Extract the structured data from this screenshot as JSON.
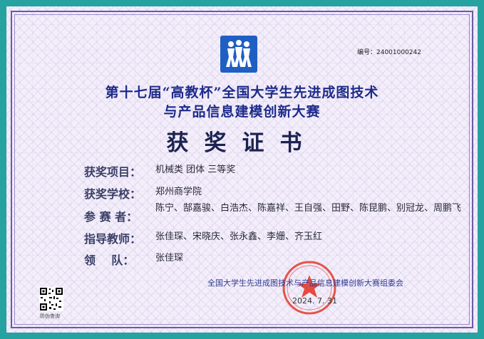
{
  "certificate": {
    "serial_no": "编号：24001000242",
    "title_line1": "第十七届“高教杯”全国大学生先进成图技术",
    "title_line2": "与产品信息建模创新大赛",
    "cert_title": "获奖证书"
  },
  "fields": {
    "project": {
      "label": "获奖项目",
      "value": "机械类 团体 三等奖"
    },
    "school": {
      "label": "获奖学校",
      "value": "郑州商学院"
    },
    "participants": {
      "label": "参 赛 者",
      "value": "陈宁、郜嘉骏、白浩杰、陈嘉祥、王自强、田野、陈昆鹏、别冠龙、周鹏飞"
    },
    "advisors": {
      "label": "指导教师",
      "value": "张佳琛、宋晓庆、张永鑫、李姗、齐玉红"
    },
    "leader": {
      "label": "领    队",
      "value": "张佳琛"
    }
  },
  "footer": {
    "organizer": "全国大学生先进成图技术与产品信息建模创新大赛组委会",
    "date": "2024. 7. 31",
    "qr_label": "防伪查询"
  },
  "colors": {
    "border": "#26a2a0",
    "title": "#1e2b8a",
    "logo": "#1f5fc4",
    "seal": "#e23a2a"
  }
}
